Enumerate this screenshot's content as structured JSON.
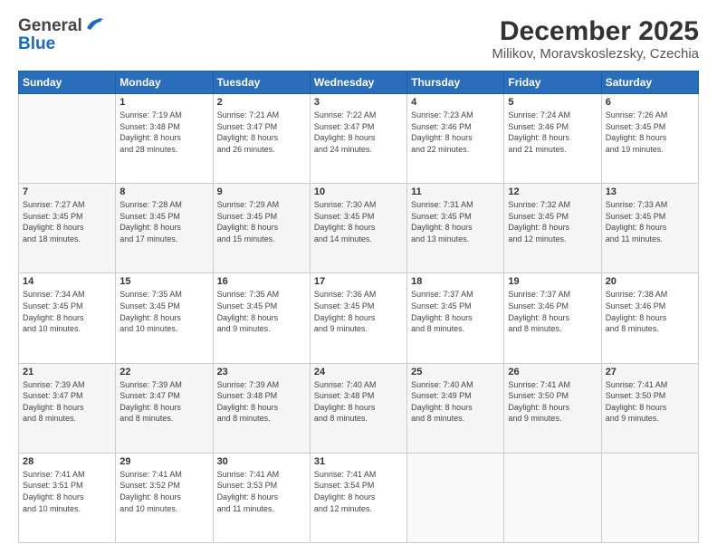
{
  "header": {
    "logo_general": "General",
    "logo_blue": "Blue",
    "title": "December 2025",
    "subtitle": "Milikov, Moravskoslezsky, Czechia"
  },
  "weekdays": [
    "Sunday",
    "Monday",
    "Tuesday",
    "Wednesday",
    "Thursday",
    "Friday",
    "Saturday"
  ],
  "weeks": [
    [
      {
        "day": "",
        "info": ""
      },
      {
        "day": "1",
        "info": "Sunrise: 7:19 AM\nSunset: 3:48 PM\nDaylight: 8 hours\nand 28 minutes."
      },
      {
        "day": "2",
        "info": "Sunrise: 7:21 AM\nSunset: 3:47 PM\nDaylight: 8 hours\nand 26 minutes."
      },
      {
        "day": "3",
        "info": "Sunrise: 7:22 AM\nSunset: 3:47 PM\nDaylight: 8 hours\nand 24 minutes."
      },
      {
        "day": "4",
        "info": "Sunrise: 7:23 AM\nSunset: 3:46 PM\nDaylight: 8 hours\nand 22 minutes."
      },
      {
        "day": "5",
        "info": "Sunrise: 7:24 AM\nSunset: 3:46 PM\nDaylight: 8 hours\nand 21 minutes."
      },
      {
        "day": "6",
        "info": "Sunrise: 7:26 AM\nSunset: 3:45 PM\nDaylight: 8 hours\nand 19 minutes."
      }
    ],
    [
      {
        "day": "7",
        "info": "Sunrise: 7:27 AM\nSunset: 3:45 PM\nDaylight: 8 hours\nand 18 minutes."
      },
      {
        "day": "8",
        "info": "Sunrise: 7:28 AM\nSunset: 3:45 PM\nDaylight: 8 hours\nand 17 minutes."
      },
      {
        "day": "9",
        "info": "Sunrise: 7:29 AM\nSunset: 3:45 PM\nDaylight: 8 hours\nand 15 minutes."
      },
      {
        "day": "10",
        "info": "Sunrise: 7:30 AM\nSunset: 3:45 PM\nDaylight: 8 hours\nand 14 minutes."
      },
      {
        "day": "11",
        "info": "Sunrise: 7:31 AM\nSunset: 3:45 PM\nDaylight: 8 hours\nand 13 minutes."
      },
      {
        "day": "12",
        "info": "Sunrise: 7:32 AM\nSunset: 3:45 PM\nDaylight: 8 hours\nand 12 minutes."
      },
      {
        "day": "13",
        "info": "Sunrise: 7:33 AM\nSunset: 3:45 PM\nDaylight: 8 hours\nand 11 minutes."
      }
    ],
    [
      {
        "day": "14",
        "info": "Sunrise: 7:34 AM\nSunset: 3:45 PM\nDaylight: 8 hours\nand 10 minutes."
      },
      {
        "day": "15",
        "info": "Sunrise: 7:35 AM\nSunset: 3:45 PM\nDaylight: 8 hours\nand 10 minutes."
      },
      {
        "day": "16",
        "info": "Sunrise: 7:35 AM\nSunset: 3:45 PM\nDaylight: 8 hours\nand 9 minutes."
      },
      {
        "day": "17",
        "info": "Sunrise: 7:36 AM\nSunset: 3:45 PM\nDaylight: 8 hours\nand 9 minutes."
      },
      {
        "day": "18",
        "info": "Sunrise: 7:37 AM\nSunset: 3:45 PM\nDaylight: 8 hours\nand 8 minutes."
      },
      {
        "day": "19",
        "info": "Sunrise: 7:37 AM\nSunset: 3:46 PM\nDaylight: 8 hours\nand 8 minutes."
      },
      {
        "day": "20",
        "info": "Sunrise: 7:38 AM\nSunset: 3:46 PM\nDaylight: 8 hours\nand 8 minutes."
      }
    ],
    [
      {
        "day": "21",
        "info": "Sunrise: 7:39 AM\nSunset: 3:47 PM\nDaylight: 8 hours\nand 8 minutes."
      },
      {
        "day": "22",
        "info": "Sunrise: 7:39 AM\nSunset: 3:47 PM\nDaylight: 8 hours\nand 8 minutes."
      },
      {
        "day": "23",
        "info": "Sunrise: 7:39 AM\nSunset: 3:48 PM\nDaylight: 8 hours\nand 8 minutes."
      },
      {
        "day": "24",
        "info": "Sunrise: 7:40 AM\nSunset: 3:48 PM\nDaylight: 8 hours\nand 8 minutes."
      },
      {
        "day": "25",
        "info": "Sunrise: 7:40 AM\nSunset: 3:49 PM\nDaylight: 8 hours\nand 8 minutes."
      },
      {
        "day": "26",
        "info": "Sunrise: 7:41 AM\nSunset: 3:50 PM\nDaylight: 8 hours\nand 9 minutes."
      },
      {
        "day": "27",
        "info": "Sunrise: 7:41 AM\nSunset: 3:50 PM\nDaylight: 8 hours\nand 9 minutes."
      }
    ],
    [
      {
        "day": "28",
        "info": "Sunrise: 7:41 AM\nSunset: 3:51 PM\nDaylight: 8 hours\nand 10 minutes."
      },
      {
        "day": "29",
        "info": "Sunrise: 7:41 AM\nSunset: 3:52 PM\nDaylight: 8 hours\nand 10 minutes."
      },
      {
        "day": "30",
        "info": "Sunrise: 7:41 AM\nSunset: 3:53 PM\nDaylight: 8 hours\nand 11 minutes."
      },
      {
        "day": "31",
        "info": "Sunrise: 7:41 AM\nSunset: 3:54 PM\nDaylight: 8 hours\nand 12 minutes."
      },
      {
        "day": "",
        "info": ""
      },
      {
        "day": "",
        "info": ""
      },
      {
        "day": "",
        "info": ""
      }
    ]
  ]
}
